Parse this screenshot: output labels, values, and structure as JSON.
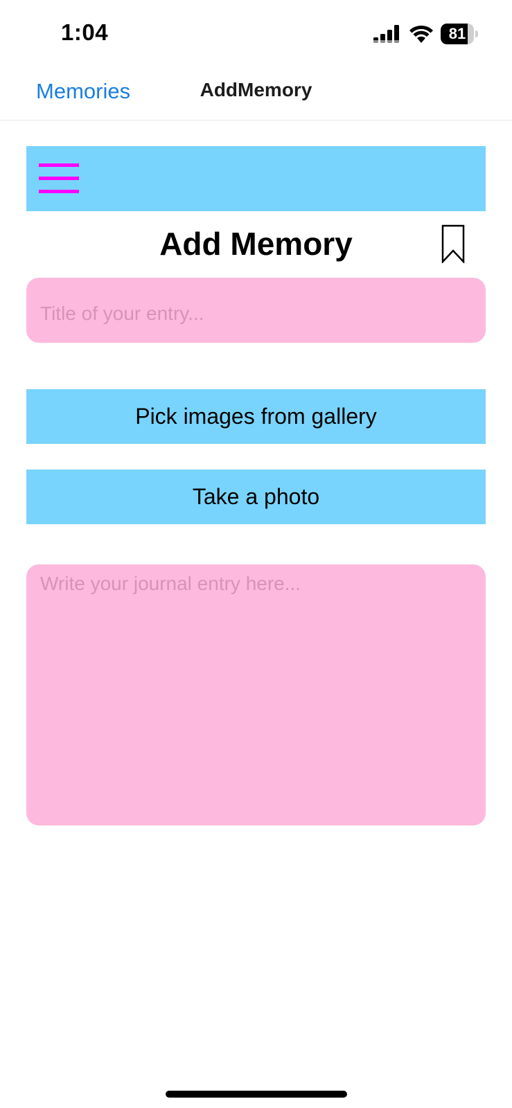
{
  "status_bar": {
    "time": "1:04",
    "battery_level": "81",
    "battery_fraction": 0.81,
    "icons": [
      "signal-icon",
      "wifi-icon",
      "battery-icon"
    ]
  },
  "nav": {
    "back_label": "Memories",
    "title": "AddMemory"
  },
  "toolbar": {
    "menu_icon": "hamburger-menu-icon",
    "menu_color": "#ff00ff",
    "background_color": "#78d4fd"
  },
  "page": {
    "heading": "Add Memory",
    "bookmark_icon": "bookmark-icon"
  },
  "form": {
    "title_placeholder": "Title of your entry...",
    "title_value": "",
    "gallery_button_label": "Pick images from gallery",
    "photo_button_label": "Take a photo",
    "journal_placeholder": "Write your journal entry here...",
    "journal_value": "",
    "input_color": "#fdb9de",
    "button_color": "#78d4fd"
  },
  "colors": {
    "accent_link": "#1a7ee0"
  }
}
